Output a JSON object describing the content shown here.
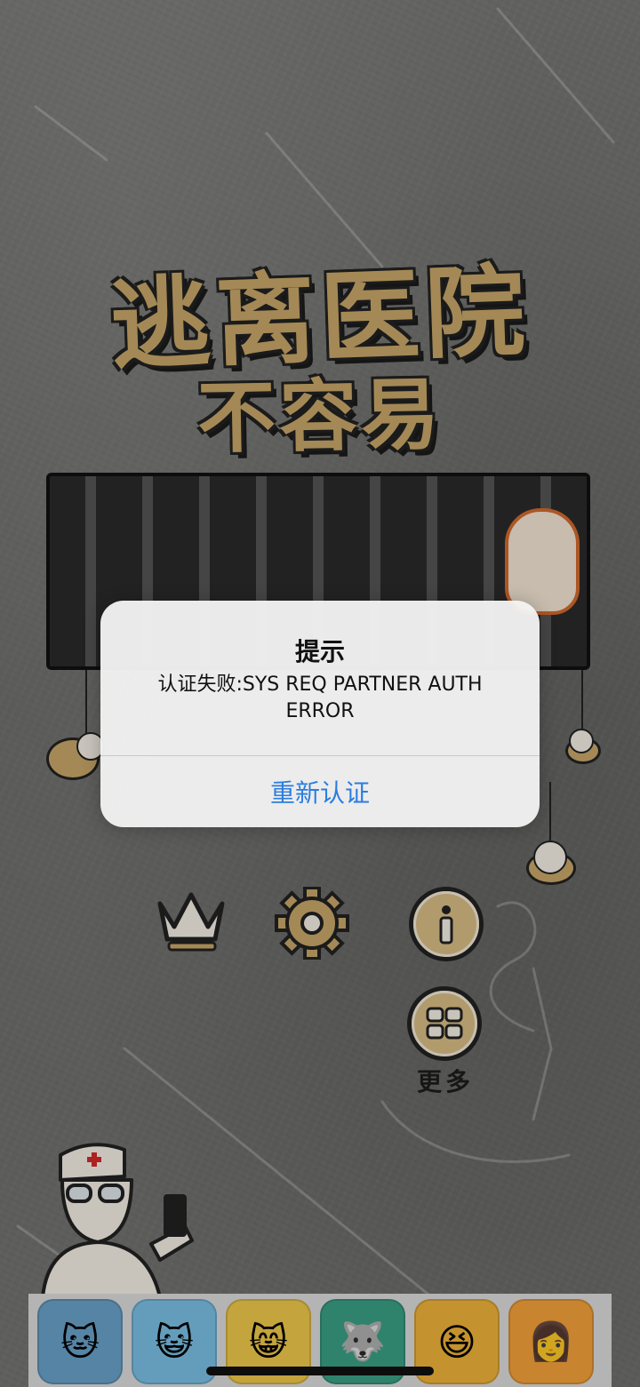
{
  "game": {
    "title_line1": "逃离医院",
    "title_line2": "不容易"
  },
  "menu": {
    "more_label": "更多",
    "icons": [
      "crown-icon",
      "gear-icon",
      "info-icon",
      "grid-icon"
    ]
  },
  "ads": {
    "icons": [
      "cat-game-icon",
      "cat2-game-icon",
      "cat3-game-icon",
      "husky-game-icon",
      "man-game-icon",
      "woman-game-icon"
    ]
  },
  "alert": {
    "title": "提示",
    "message": "认证失败:SYS REQ PARTNER AUTH ERROR",
    "button": "重新认证"
  },
  "colors": {
    "gold": "#c9a86a",
    "link_blue": "#2a7de0"
  }
}
